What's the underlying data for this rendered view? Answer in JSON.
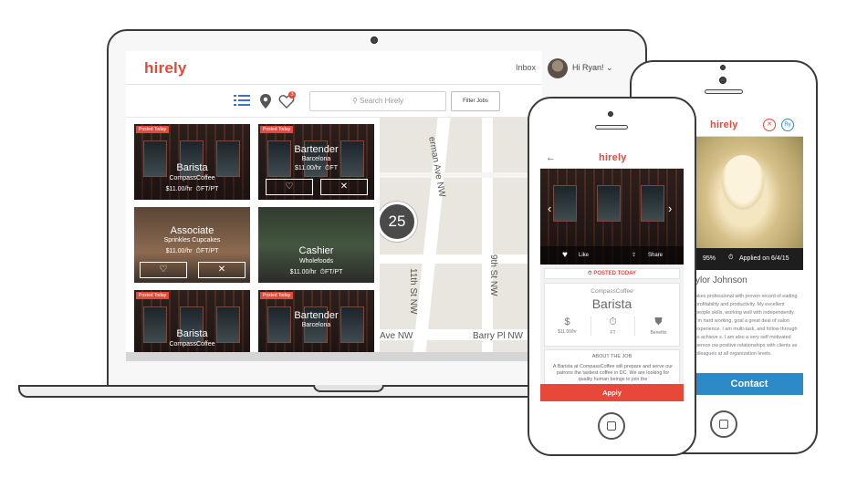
{
  "brand": {
    "logo": "hirely",
    "accent": "#e8483a",
    "contact_color": "#2d8ac6"
  },
  "laptop": {
    "header": {
      "logo": "hirely",
      "inbox": "Inbox",
      "greeting": "Hi Ryan!",
      "caret": "⌄"
    },
    "toolbar": {
      "list_icon": "list-icon",
      "pin_icon": "map-pin-icon",
      "heart_icon": "heart-icon",
      "heart_badge": "3",
      "search_placeholder": "Search Hirely",
      "filter_label": "Filter Jobs"
    },
    "cards": [
      {
        "posted": "Posted Today",
        "title": "Barista",
        "company": "CompassCoffee",
        "pay": "$11.00/hr",
        "type": "FT/PT",
        "image": "coffee-shop-photo"
      },
      {
        "posted": "Posted Today",
        "title": "Bartender",
        "company": "Barcelona",
        "pay": "$11.00/hr",
        "type": "FT",
        "image": "coffee-shop-photo"
      },
      {
        "posted": "",
        "title": "Associate",
        "company": "Sprinkles Cupcakes",
        "pay": "$11.00/hr",
        "type": "FT/PT",
        "image": "cafe-interior-photo"
      },
      {
        "posted": "",
        "title": "Cashier",
        "company": "Wholefoods",
        "pay": "$11.00/hr",
        "type": "FT/PT",
        "image": "grocery-store-photo"
      },
      {
        "posted": "Posted Today",
        "title": "Barista",
        "company": "CompassCoffee",
        "pay": "",
        "type": "",
        "image": "coffee-shop-photo"
      },
      {
        "posted": "Posted Today",
        "title": "Bartender",
        "company": "Barcelona",
        "pay": "",
        "type": "",
        "image": "coffee-shop-photo"
      }
    ],
    "card_actions": {
      "like": "♡",
      "dismiss": "✕"
    },
    "map": {
      "cluster_count": "25",
      "streets": [
        "erman Ave NW",
        "11th St NW",
        "9th St NW",
        "Ave NW",
        "Barry Pl NW"
      ]
    }
  },
  "phone_back": {
    "logo": "hirely",
    "close": "✕",
    "avatar_initials": "Ry",
    "photo_pct": "95%",
    "applied": "Applied on 6/4/15",
    "name": "ylor Johnson",
    "bio": "akes professional with proven record of eading profitability and productivity. My excellent people skills, working well with independently. I'm hard working, goal a great deal of salon experience. I am multi-task, and follow through to achieve s. I am also a very self motivated person ow positive relationships with clients as olleagues at all organization levels.",
    "contact": "Contact"
  },
  "phone_front": {
    "back": "←",
    "logo": "hirely",
    "like": "Like",
    "share": "Share",
    "posted": "POSTED TODAY",
    "company": "CompassCoffee",
    "title": "Barista",
    "pay_icon": "$",
    "pay": "$11.00/hr",
    "hours": "FT",
    "benefits": "Benefits",
    "about_heading": "ABOUT THE JOB",
    "about_text": "A Barista at CompassCoffee will prepare and serve our patrons the tastiest coffee in DC. We are looking for quality human beings to join the",
    "apply": "Apply"
  }
}
